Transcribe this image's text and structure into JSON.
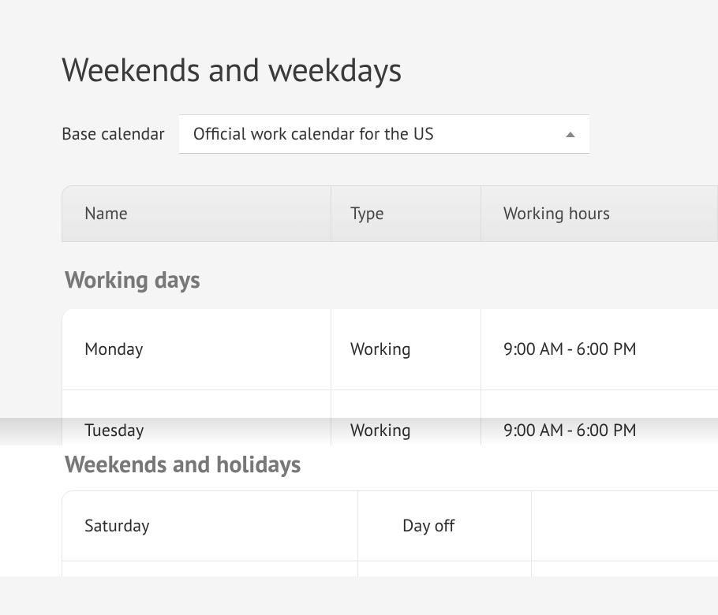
{
  "page": {
    "title": "Weekends and weekdays"
  },
  "baseCalendar": {
    "label": "Base calendar",
    "selected": "Official work calendar for the US"
  },
  "table": {
    "columns": {
      "name": "Name",
      "type": "Type",
      "hours": "Working hours"
    }
  },
  "sections": {
    "working": {
      "title": "Working days",
      "rows": [
        {
          "name": "Monday",
          "type": "Working",
          "hours": "9:00 AM - 6:00 PM"
        },
        {
          "name": "Tuesday",
          "type": "Working",
          "hours": "9:00 AM - 6:00 PM"
        }
      ]
    },
    "weekends": {
      "title": "Weekends and holidays",
      "rows": [
        {
          "name": "Saturday",
          "type": "Day off",
          "hours": ""
        }
      ]
    }
  }
}
